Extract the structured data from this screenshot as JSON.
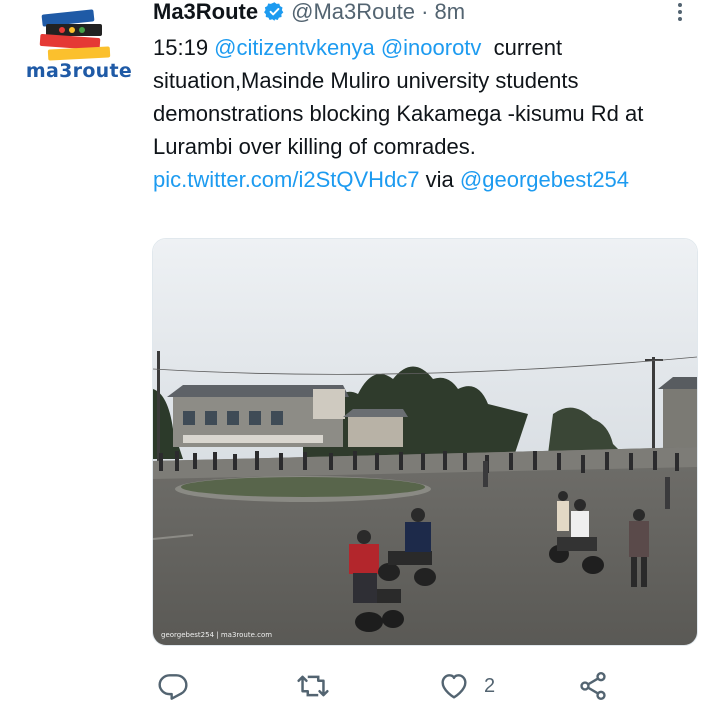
{
  "tweet": {
    "display_name": "Ma3Route",
    "handle": "@Ma3Route",
    "separator": "·",
    "time": "8m",
    "avatar_logo_text": "ma3route",
    "text": {
      "prefix": "15:19 ",
      "mention1": "@citizentvkenya",
      "space": " ",
      "mention2": "@inoorotv",
      "body": "  current situation,Masinde Muliro university students demonstrations blocking Kakamega -kisumu Rd at Lurambi over killing of comrades. ",
      "pic_link": "pic.twitter.com/i2StQVHdc7",
      "via": " via ",
      "via_mention": "@georgebest254"
    },
    "media": {
      "watermark": "georgebest254 | ma3route.com"
    },
    "actions": {
      "reply_icon": "reply-icon",
      "retweet_icon": "retweet-icon",
      "like_icon": "heart-icon",
      "like_count": "2",
      "share_icon": "share-icon"
    }
  },
  "colors": {
    "link": "#1d9bf0",
    "secondary_text": "#536471",
    "verified": "#1d9bf0"
  }
}
